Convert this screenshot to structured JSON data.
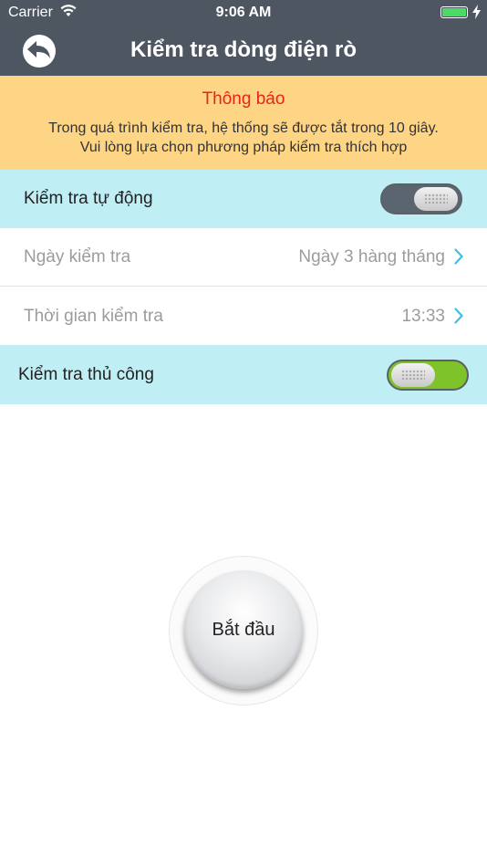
{
  "status_bar": {
    "carrier": "Carrier",
    "time": "9:06 AM"
  },
  "nav": {
    "title": "Kiểm tra dòng điện rò",
    "back_icon": "back-arrow-icon"
  },
  "notice": {
    "title": "Thông báo",
    "line1": "Trong quá trình kiểm tra, hệ thống sẽ được tắt trong 10 giây.",
    "line2": "Vui lòng lựa chọn phương pháp kiểm tra thích hợp"
  },
  "auto_test": {
    "label": "Kiểm tra tự động",
    "enabled": false
  },
  "test_day": {
    "label": "Ngày kiểm tra",
    "value": "Ngày 3 hàng tháng"
  },
  "test_time": {
    "label": "Thời gian kiểm tra",
    "value": "13:33"
  },
  "manual_test": {
    "label": "Kiểm tra thủ công",
    "enabled": true
  },
  "start_button": {
    "label": "Bắt đầu"
  },
  "colors": {
    "nav_bg": "#4e5761",
    "notice_bg": "#fed584",
    "notice_title": "#e8231c",
    "row_blue": "#bfeef4",
    "toggle_on": "#7ec32a",
    "chevron": "#43bfe0"
  }
}
